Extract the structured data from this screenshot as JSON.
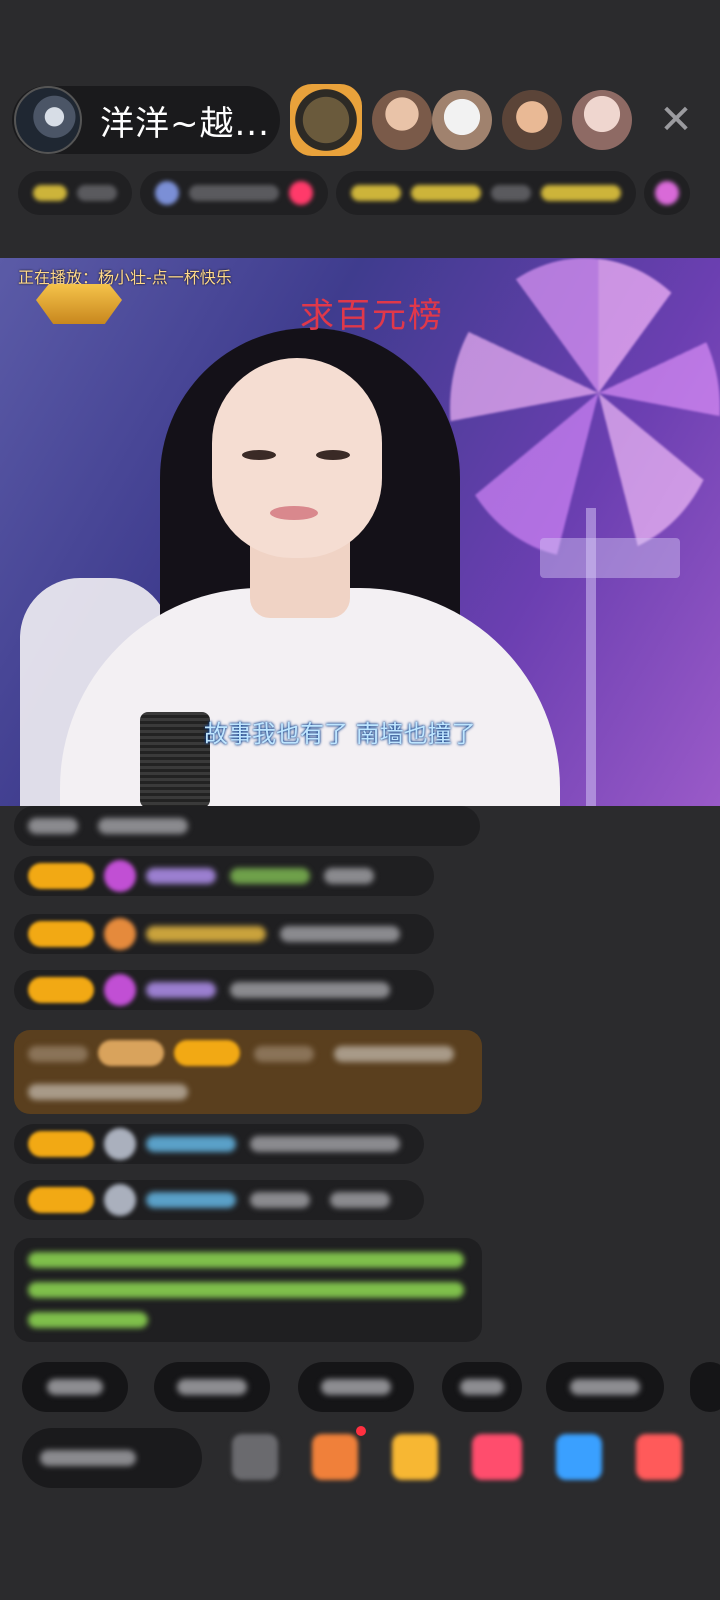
{
  "header": {
    "host_name": "洋洋~越...",
    "close_glyph": "✕"
  },
  "video": {
    "now_playing": "正在播放：杨小壮-点一杯快乐",
    "banner": "求百元榜",
    "subtitle": "故事我也有了  南墙也撞了"
  },
  "colors": {
    "background": "#2b2b2d",
    "banner_red": "#e0384a",
    "level_badge": "#f2a914",
    "chat_green": "#7fc04b"
  },
  "icons": [
    "close-icon",
    "microphone-icon",
    "gift-icon",
    "emoji-icon",
    "share-icon"
  ]
}
